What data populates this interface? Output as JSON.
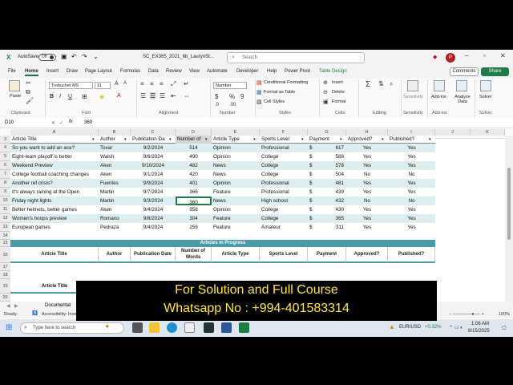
{
  "window": {
    "autosave": "AutoSave",
    "toggle": "Off",
    "filename": "SC_EX365_2021_6b_LaurynSt...",
    "search_placeholder": "Search",
    "avatar_initial": "P"
  },
  "menu": {
    "items": [
      "File",
      "Home",
      "Insert",
      "Draw",
      "Page Layout",
      "Formulas",
      "Data",
      "Review",
      "View",
      "Automate",
      "Developer",
      "Help",
      "Power Pivot",
      "Table Design"
    ],
    "comments": "Comments",
    "share": "Share"
  },
  "ribbon": {
    "font_name": "Trebuchet MS",
    "font_size": "11",
    "number_format": "Number",
    "groups": [
      "Clipboard",
      "Font",
      "Alignment",
      "Number",
      "Styles",
      "Cells",
      "Editing",
      "Sensitivity",
      "Add-ins",
      "Solver"
    ],
    "paste": "Paste",
    "cond_fmt": "Conditional Formatting",
    "fmt_table": "Format as Table",
    "cell_styles": "Cell Styles",
    "insert": "Insert",
    "delete": "Delete",
    "format": "Format",
    "editing": "Editing",
    "sensitivity": "Sensitivity",
    "addins": "Add-ins",
    "analyze": "Analyze Data",
    "solver": "Solver"
  },
  "formula": {
    "cell_ref": "D10",
    "fx": "fx",
    "value": "360"
  },
  "columns": [
    "A",
    "B",
    "C",
    "D",
    "E",
    "F",
    "G",
    "H",
    "I",
    "J",
    "K"
  ],
  "table": {
    "headers": [
      "Article Title",
      "Author",
      "Publication Da",
      "Number of",
      "Article Type",
      "Sports Level",
      "Payment",
      "Approved?",
      "Published?"
    ],
    "rows": [
      {
        "n": "4",
        "title": "So you want to add an ace?",
        "author": "Tovar",
        "date": "9/2/2024",
        "words": "514",
        "type": "Opinion",
        "level": "Professional",
        "cur": "$",
        "pay": "617",
        "appr": "Yes",
        "pub": "Yes"
      },
      {
        "n": "5",
        "title": "Eight-team playoff is better",
        "author": "Walsh",
        "date": "9/6/2024",
        "words": "490",
        "type": "Opinion",
        "level": "College",
        "cur": "$",
        "pay": "588",
        "appr": "Yes",
        "pub": "Yes"
      },
      {
        "n": "6",
        "title": "Weekend Preview",
        "author": "Aken",
        "date": "9/10/2024",
        "words": "482",
        "type": "News",
        "level": "College",
        "cur": "$",
        "pay": "578",
        "appr": "Yes",
        "pub": "Yes"
      },
      {
        "n": "7",
        "title": "College football coaching changes",
        "author": "Aken",
        "date": "9/1/2024",
        "words": "420",
        "type": "News",
        "level": "College",
        "cur": "$",
        "pay": "504",
        "appr": "No",
        "pub": "No"
      },
      {
        "n": "8",
        "title": "Another ref crisis?",
        "author": "Fuentes",
        "date": "9/9/2024",
        "words": "401",
        "type": "Opinion",
        "level": "Professional",
        "cur": "$",
        "pay": "481",
        "appr": "Yes",
        "pub": "Yes"
      },
      {
        "n": "9",
        "title": "It's always raining at the Open",
        "author": "Martin",
        "date": "9/7/2024",
        "words": "366",
        "type": "Feature",
        "level": "Professional",
        "cur": "$",
        "pay": "439",
        "appr": "Yes",
        "pub": "Yes"
      },
      {
        "n": "10",
        "title": "Friday night lights",
        "author": "Martin",
        "date": "9/3/2024",
        "words": "360",
        "type": "News",
        "level": "High school",
        "cur": "$",
        "pay": "432",
        "appr": "No",
        "pub": "No"
      },
      {
        "n": "11",
        "title": "Better helmets, better games",
        "author": "Aken",
        "date": "9/4/2024",
        "words": "358",
        "type": "Opinion",
        "level": "College",
        "cur": "$",
        "pay": "430",
        "appr": "Yes",
        "pub": "Yes"
      },
      {
        "n": "12",
        "title": "Women's hoops preview",
        "author": "Romano",
        "date": "9/8/2024",
        "words": "304",
        "type": "Feature",
        "level": "College",
        "cur": "$",
        "pay": "365",
        "appr": "Yes",
        "pub": "Yes"
      },
      {
        "n": "13",
        "title": "European games",
        "author": "Pedraza",
        "date": "9/4/2024",
        "words": "259",
        "type": "Feature",
        "level": "Amateur",
        "cur": "$",
        "pay": "311",
        "appr": "Yes",
        "pub": "Yes"
      }
    ]
  },
  "progress": {
    "title": "Articles in Progress",
    "headers": [
      "Article Title",
      "Author",
      "Publication Date",
      "Number of Words",
      "Article Type",
      "Sports Level",
      "Payment",
      "Approved?",
      "Published?"
    ]
  },
  "row_numbers_lower": [
    "14",
    "15",
    "16",
    "17",
    "18",
    "19",
    "20"
  ],
  "second_header": "Article Title",
  "sheet_tab": "Documentat",
  "status": {
    "ready": "Ready",
    "accessibility": "Accessibility: Inve",
    "zoom": "100%"
  },
  "taskbar": {
    "search": "Type here to search",
    "ticker": "EUR/USD",
    "change": "+0.32%",
    "time": "1:06 AM",
    "date": "8/15/2025"
  },
  "overlay": {
    "line1": "For Solution and Full Course",
    "line2": "Whatsapp No : +994-401583314"
  }
}
